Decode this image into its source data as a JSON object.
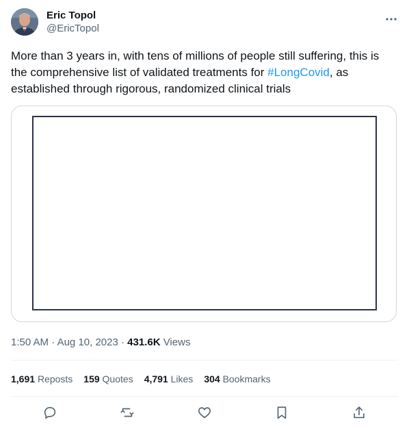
{
  "author": {
    "display_name": "Eric Topol",
    "handle": "@EricTopol"
  },
  "tweet": {
    "text_before": "More than 3 years in, with tens of millions of people still suffering, this is the comprehensive list of validated treatments for ",
    "hashtag": "#LongCovid",
    "text_after": ", as established through rigorous, randomized clinical trials"
  },
  "meta": {
    "time": "1:50 AM",
    "date": "Aug 10, 2023",
    "views_count": "431.6K",
    "views_label": "Views"
  },
  "stats": {
    "reposts_count": "1,691",
    "reposts_label": "Reposts",
    "quotes_count": "159",
    "quotes_label": "Quotes",
    "likes_count": "4,791",
    "likes_label": "Likes",
    "bookmarks_count": "304",
    "bookmarks_label": "Bookmarks"
  },
  "icons": {
    "more": "more-icon",
    "reply": "reply-icon",
    "repost": "repost-icon",
    "like": "like-icon",
    "bookmark": "bookmark-icon",
    "share": "share-icon"
  },
  "colors": {
    "link": "#1d9bf0",
    "text": "#0f1419",
    "secondary": "#536471",
    "border": "#cfd9de",
    "frame": "#2a3248"
  }
}
